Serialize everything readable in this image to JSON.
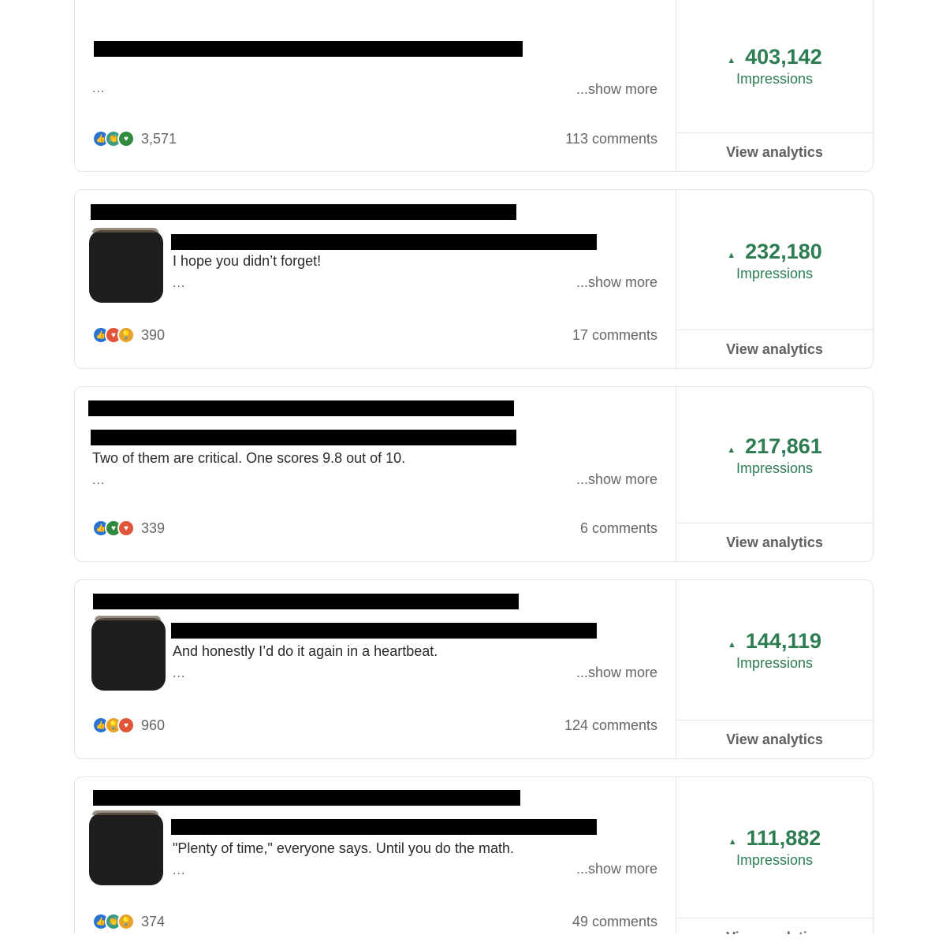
{
  "posts": [
    {
      "snippet": "",
      "ellipsis": "...",
      "show_more": "...show more",
      "reactions": [
        "like-icon",
        "celebrate-icon",
        "support-icon"
      ],
      "reaction_count": "3,571",
      "comments": "113 comments",
      "impressions": "403,142",
      "impressions_label": "Impressions",
      "view_analytics": "View analytics"
    },
    {
      "snippet": "I hope you didn’t forget!",
      "ellipsis": "...",
      "show_more": "...show more",
      "reactions": [
        "like-icon",
        "love-icon",
        "insight-icon"
      ],
      "reaction_count": "390",
      "comments": "17 comments",
      "impressions": "232,180",
      "impressions_label": "Impressions",
      "view_analytics": "View analytics"
    },
    {
      "snippet": "Two of them are critical. One scores 9.8 out of 10.",
      "ellipsis": "...",
      "show_more": "...show more",
      "reactions": [
        "like-icon",
        "support-icon",
        "love-icon"
      ],
      "reaction_count": "339",
      "comments": "6 comments",
      "impressions": "217,861",
      "impressions_label": "Impressions",
      "view_analytics": "View analytics"
    },
    {
      "snippet": "And honestly I’d do it again in a heartbeat.",
      "ellipsis": "...",
      "show_more": "...show more",
      "reactions": [
        "like-icon",
        "insight-icon",
        "love-icon"
      ],
      "reaction_count": "960",
      "comments": "124 comments",
      "impressions": "144,119",
      "impressions_label": "Impressions",
      "view_analytics": "View analytics"
    },
    {
      "snippet": "\"Plenty of time,\" everyone says. Until you do the math.",
      "ellipsis": "...",
      "show_more": "...show more",
      "reactions": [
        "like-icon",
        "celebrate-icon",
        "insight-icon"
      ],
      "reaction_count": "374",
      "comments": "49 comments",
      "impressions": "111,882",
      "impressions_label": "Impressions",
      "view_analytics": "View analytics"
    }
  ],
  "colors": {
    "impressions_green": "#2e7d52",
    "border": "#e4e4e4",
    "muted_text": "#666666"
  }
}
